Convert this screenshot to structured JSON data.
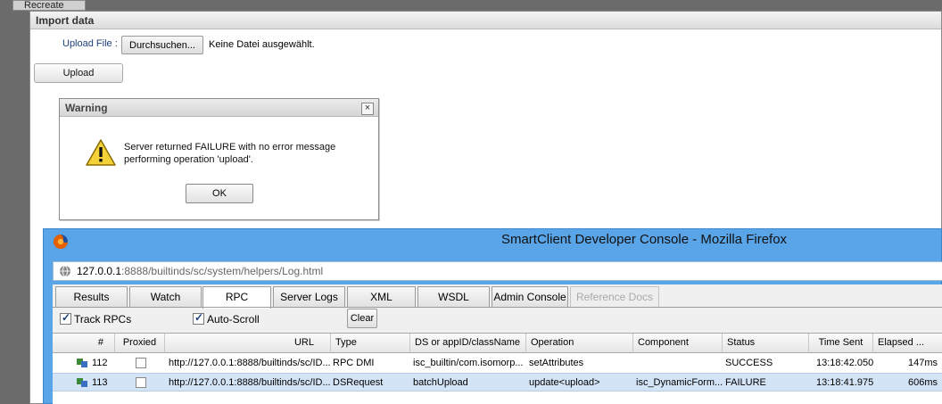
{
  "background": {
    "tab_label": "Recreate"
  },
  "import_window": {
    "title": "Import data",
    "upload_file_label": "Upload File :",
    "browse_button": "Durchsuchen...",
    "no_file_text": "Keine Datei ausgewählt.",
    "upload_button": "Upload"
  },
  "warning_dialog": {
    "title": "Warning",
    "close_glyph": "×",
    "message_line1": "Server returned FAILURE with no error message",
    "message_line2": "performing operation 'upload'.",
    "ok_button": "OK"
  },
  "firefox": {
    "title": "SmartClient Developer Console - Mozilla Firefox",
    "url_host": "127.0.0.1",
    "url_rest": ":8888/builtinds/sc/system/helpers/Log.html",
    "tabs": [
      {
        "label": "Results"
      },
      {
        "label": "Watch"
      },
      {
        "label": "RPC"
      },
      {
        "label": "Server Logs"
      },
      {
        "label": "XML"
      },
      {
        "label": "WSDL"
      },
      {
        "label": "Admin Console"
      },
      {
        "label": "Reference Docs"
      }
    ],
    "track_rpcs_label": "Track RPCs",
    "auto_scroll_label": "Auto-Scroll",
    "clear_button": "Clear",
    "columns": [
      "#",
      "Proxied",
      "URL",
      "Type",
      "DS or appID/className",
      "Operation",
      "Component",
      "Status",
      "Time Sent",
      "Elapsed ..."
    ],
    "rows": [
      {
        "num": "112",
        "url": "http://127.0.0.1:8888/builtinds/sc/ID...",
        "type": "RPC DMI",
        "ds": "isc_builtin/com.isomorp...",
        "operation": "setAttributes",
        "component": "",
        "status": "SUCCESS",
        "time_sent": "13:18:42.050",
        "elapsed": "147ms"
      },
      {
        "num": "113",
        "url": "http://127.0.0.1:8888/builtinds/sc/ID...",
        "type": "DSRequest",
        "ds": "batchUpload",
        "operation": "update<upload>",
        "component": "isc_DynamicForm...",
        "status": "FAILURE",
        "time_sent": "13:18:41.975",
        "elapsed": "606ms"
      }
    ]
  },
  "colors": {
    "firefox_titlebar": "#5aa4e8",
    "selected_row": "#d4e4f7",
    "label_blue": "#1d3f7a"
  }
}
